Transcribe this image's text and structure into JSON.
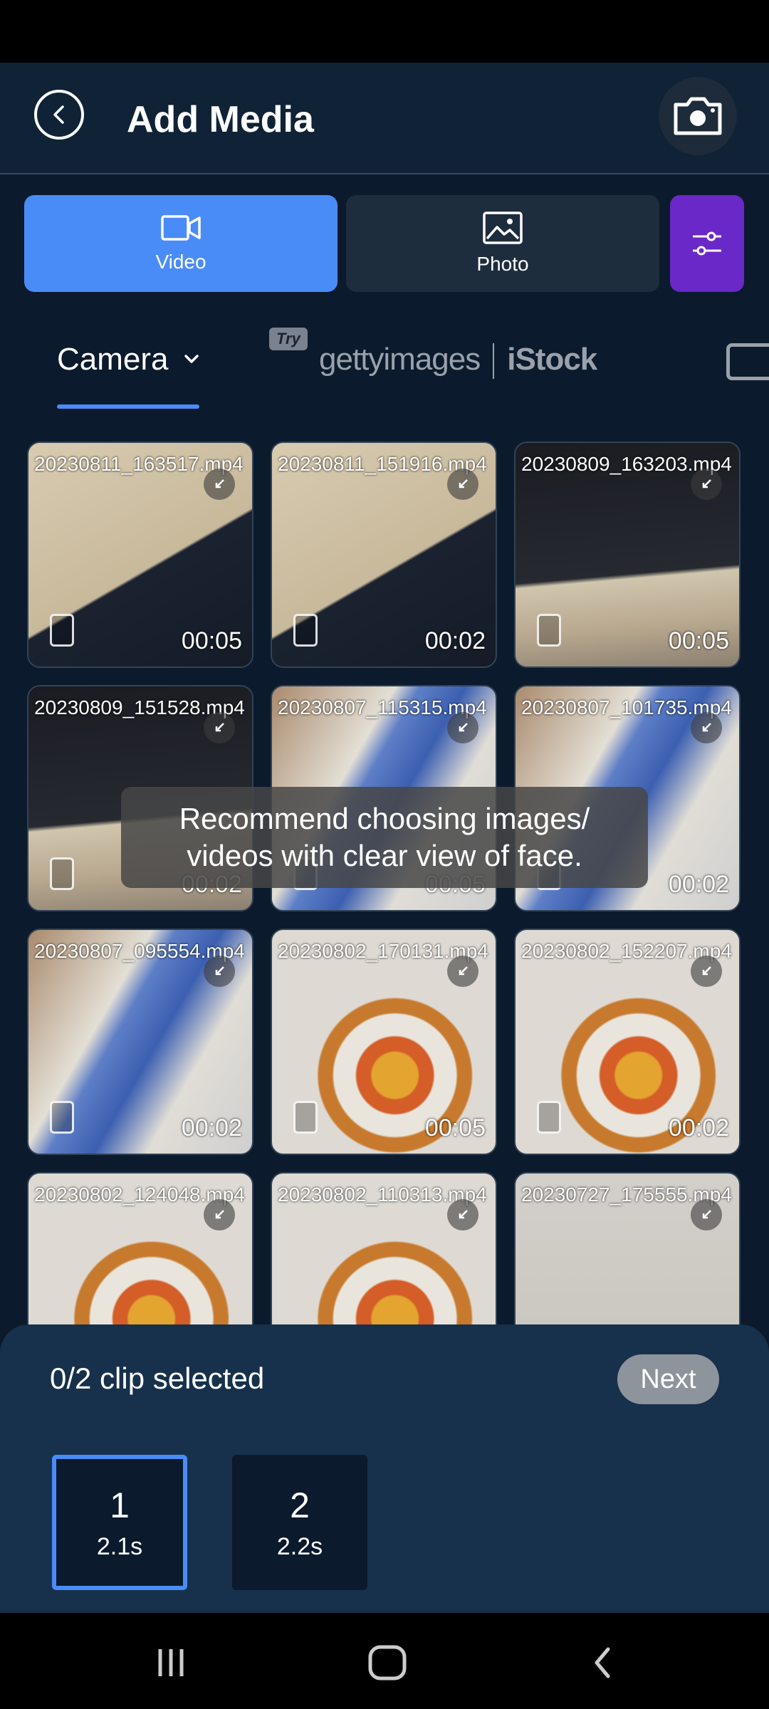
{
  "header": {
    "title": "Add Media"
  },
  "mode_tabs": [
    {
      "label": "Video"
    },
    {
      "label": "Photo"
    }
  ],
  "source": {
    "camera_label": "Camera",
    "try_badge": "Try",
    "getty": "gettyimages",
    "istock": "iStock"
  },
  "media": [
    {
      "name": "20230811_163517.mp4",
      "duration": "00:05"
    },
    {
      "name": "20230811_151916.mp4",
      "duration": "00:02"
    },
    {
      "name": "20230809_163203.mp4",
      "duration": "00:05"
    },
    {
      "name": "20230809_151528.mp4",
      "duration": "00:02"
    },
    {
      "name": "20230807_115315.mp4",
      "duration": "00:05"
    },
    {
      "name": "20230807_101735.mp4",
      "duration": "00:02"
    },
    {
      "name": "20230807_095554.mp4",
      "duration": "00:02"
    },
    {
      "name": "20230802_170131.mp4",
      "duration": "00:05"
    },
    {
      "name": "20230802_152207.mp4",
      "duration": "00:02"
    },
    {
      "name": "20230802_124048.mp4",
      "duration": ""
    },
    {
      "name": "20230802_110313.mp4",
      "duration": ""
    },
    {
      "name": "20230727_175555.mp4",
      "duration": ""
    }
  ],
  "toast": "Recommend choosing images/\nvideos with clear view of face.",
  "selection": {
    "text": "0/2 clip selected",
    "next_label": "Next",
    "slots": [
      {
        "num": "1",
        "len": "2.1s"
      },
      {
        "num": "2",
        "len": "2.2s"
      }
    ]
  },
  "colors": {
    "accent": "#4a8cf7",
    "filter": "#6a28c8",
    "panel": "#17314c",
    "bg": "#0b1a2c"
  },
  "icons": [
    "back-icon",
    "camera-icon",
    "video-icon",
    "photo-icon",
    "filter-icon",
    "chevron-down-icon",
    "shrink-icon",
    "film-icon"
  ]
}
